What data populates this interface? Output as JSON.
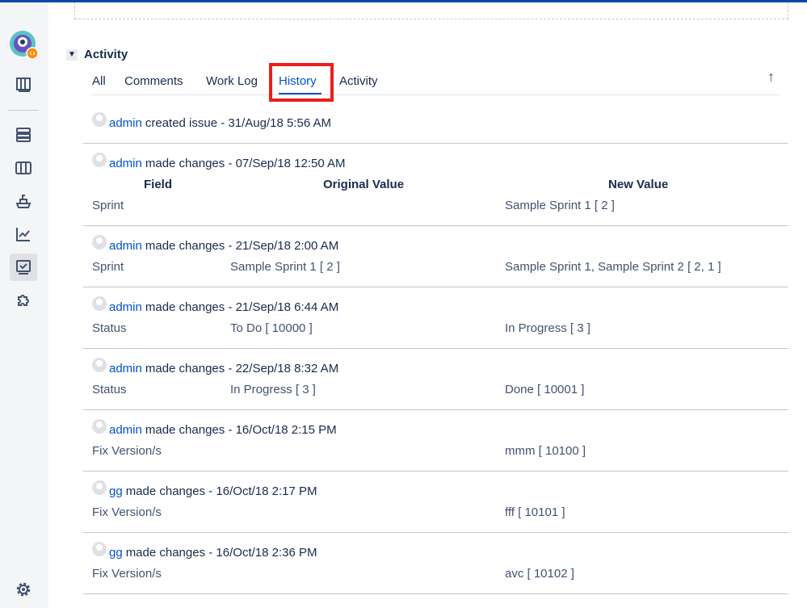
{
  "activity": {
    "title": "Activity",
    "tabs": [
      {
        "label": "All"
      },
      {
        "label": "Comments"
      },
      {
        "label": "Work Log"
      },
      {
        "label": "History"
      },
      {
        "label": "Activity"
      }
    ],
    "active_tab": "History"
  },
  "history": {
    "created": {
      "user": "admin",
      "text": "created issue - 31/Aug/18 5:56 AM"
    },
    "columns": {
      "field": "Field",
      "original": "Original Value",
      "new": "New Value"
    },
    "entries": [
      {
        "user": "admin",
        "text": "made changes - 07/Sep/18 12:50 AM",
        "field": "Sprint",
        "original": "",
        "new": "Sample Sprint 1 [ 2 ]"
      },
      {
        "user": "admin",
        "text": "made changes - 21/Sep/18 2:00 AM",
        "field": "Sprint",
        "original": "Sample Sprint 1 [ 2 ]",
        "new": "Sample Sprint 1, Sample Sprint 2 [ 2, 1 ]"
      },
      {
        "user": "admin",
        "text": "made changes - 21/Sep/18 6:44 AM",
        "field": "Status",
        "original": "To Do [ 10000 ]",
        "new": "In Progress [ 3 ]"
      },
      {
        "user": "admin",
        "text": "made changes - 22/Sep/18 8:32 AM",
        "field": "Status",
        "original": "In Progress [ 3 ]",
        "new": "Done [ 10001 ]"
      },
      {
        "user": "admin",
        "text": "made changes - 16/Oct/18 2:15 PM",
        "field": "Fix Version/s",
        "original": "",
        "new": "mmm [ 10100 ]"
      },
      {
        "user": "gg",
        "text": "made changes - 16/Oct/18 2:17 PM",
        "field": "Fix Version/s",
        "original": "",
        "new": "fff [ 10101 ]"
      },
      {
        "user": "gg",
        "text": "made changes - 16/Oct/18 2:36 PM",
        "field": "Fix Version/s",
        "original": "",
        "new": "avc [ 10102 ]"
      }
    ]
  },
  "sidebar": {
    "icons": [
      "project-avatar-icon",
      "board-icon",
      "backlog-icon",
      "columns-icon",
      "releases-icon",
      "reports-icon",
      "issues-icon",
      "add-ons-icon",
      "settings-icon"
    ]
  },
  "colors": {
    "accent": "#0052cc",
    "highlight": "#e8201a",
    "topbar": "#0747a6"
  }
}
